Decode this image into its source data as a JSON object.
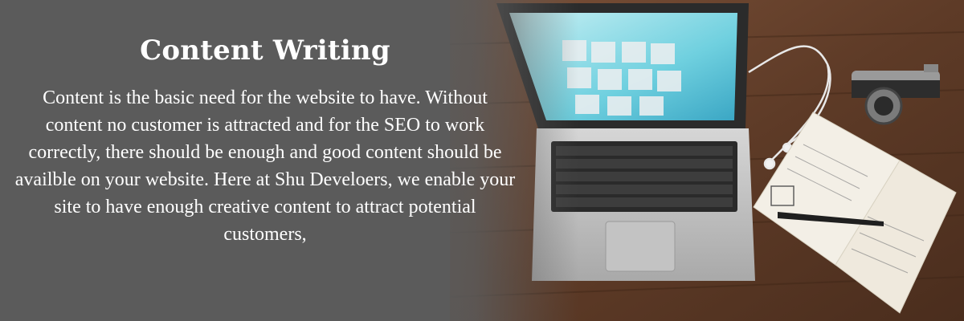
{
  "banner": {
    "heading": "Content Writing",
    "body": "Content is the basic need for the website to have. Without content no customer is attracted and for the SEO to work correctly, there should be enough and good content should be availble on your website. Here at Shu Develoers, we enable your site to have enough creative content to attract potential customers,"
  },
  "colors": {
    "panel": "#5b5b5b",
    "text": "#ffffff",
    "wood": "#6b4630"
  },
  "icons": {
    "laptop": "laptop-icon",
    "camera": "camera-icon",
    "notebook": "notebook-icon",
    "pen": "pen-icon",
    "earphones": "earphones-icon"
  }
}
